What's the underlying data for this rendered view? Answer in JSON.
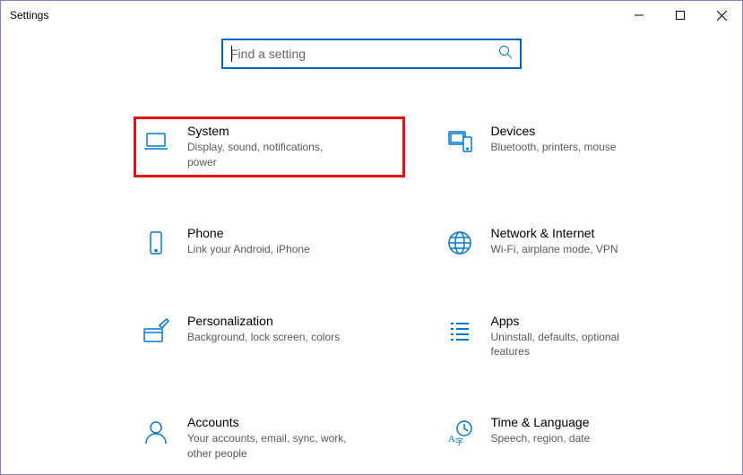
{
  "window": {
    "title": "Settings"
  },
  "search": {
    "placeholder": "Find a setting"
  },
  "categories": [
    {
      "id": "system",
      "title": "System",
      "desc": "Display, sound, notifications, power",
      "highlighted": true
    },
    {
      "id": "devices",
      "title": "Devices",
      "desc": "Bluetooth, printers, mouse",
      "highlighted": false
    },
    {
      "id": "phone",
      "title": "Phone",
      "desc": "Link your Android, iPhone",
      "highlighted": false
    },
    {
      "id": "network",
      "title": "Network & Internet",
      "desc": "Wi-Fi, airplane mode, VPN",
      "highlighted": false
    },
    {
      "id": "personalization",
      "title": "Personalization",
      "desc": "Background, lock screen, colors",
      "highlighted": false
    },
    {
      "id": "apps",
      "title": "Apps",
      "desc": "Uninstall, defaults, optional features",
      "highlighted": false
    },
    {
      "id": "accounts",
      "title": "Accounts",
      "desc": "Your accounts, email, sync, work, other people",
      "highlighted": false
    },
    {
      "id": "time",
      "title": "Time & Language",
      "desc": "Speech, region, date",
      "highlighted": false
    }
  ]
}
